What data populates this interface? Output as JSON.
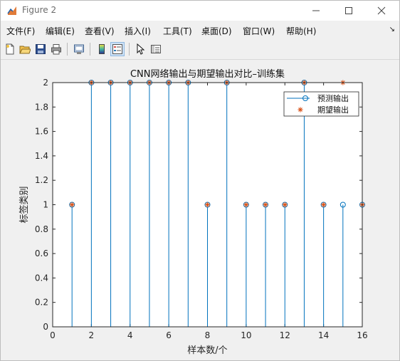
{
  "window": {
    "title": "Figure 2",
    "controls": [
      "minimize",
      "maximize",
      "close"
    ]
  },
  "menu": {
    "items": [
      "文件(F)",
      "编辑(E)",
      "查看(V)",
      "插入(I)",
      "工具(T)",
      "桌面(D)",
      "窗口(W)",
      "帮助(H)"
    ]
  },
  "toolbar": {
    "icons": [
      "new-figure-icon",
      "open-file-icon",
      "save-icon",
      "print-icon",
      "print-preview-icon",
      "colorbar-icon",
      "legend-icon",
      "pointer-icon",
      "property-editor-icon"
    ]
  },
  "chart_data": {
    "type": "stem",
    "title": "CNN网络输出与期望输出对比–训练集",
    "xlabel": "样本数/个",
    "ylabel": "标签类别",
    "xlim": [
      0,
      16
    ],
    "ylim": [
      0,
      2
    ],
    "xticks": [
      "0",
      "2",
      "4",
      "6",
      "8",
      "10",
      "12",
      "14",
      "16"
    ],
    "yticks": [
      "0",
      "0.2",
      "0.4",
      "0.6",
      "0.8",
      "1",
      "1.2",
      "1.4",
      "1.6",
      "1.8",
      "2"
    ],
    "x": [
      1,
      2,
      3,
      4,
      5,
      6,
      7,
      8,
      9,
      10,
      11,
      12,
      13,
      14,
      15,
      16
    ],
    "series": [
      {
        "name": "预测输出",
        "style": "stem-circle",
        "color": "#0072BD",
        "values": [
          1,
          2,
          2,
          2,
          2,
          2,
          2,
          1,
          2,
          1,
          1,
          1,
          2,
          1,
          1,
          1
        ]
      },
      {
        "name": "期望输出",
        "style": "asterisk",
        "color": "#D95319",
        "values": [
          1,
          2,
          2,
          2,
          2,
          2,
          2,
          1,
          2,
          1,
          1,
          1,
          2,
          1,
          2,
          1
        ]
      }
    ],
    "legend": "top-right",
    "grid": false
  }
}
